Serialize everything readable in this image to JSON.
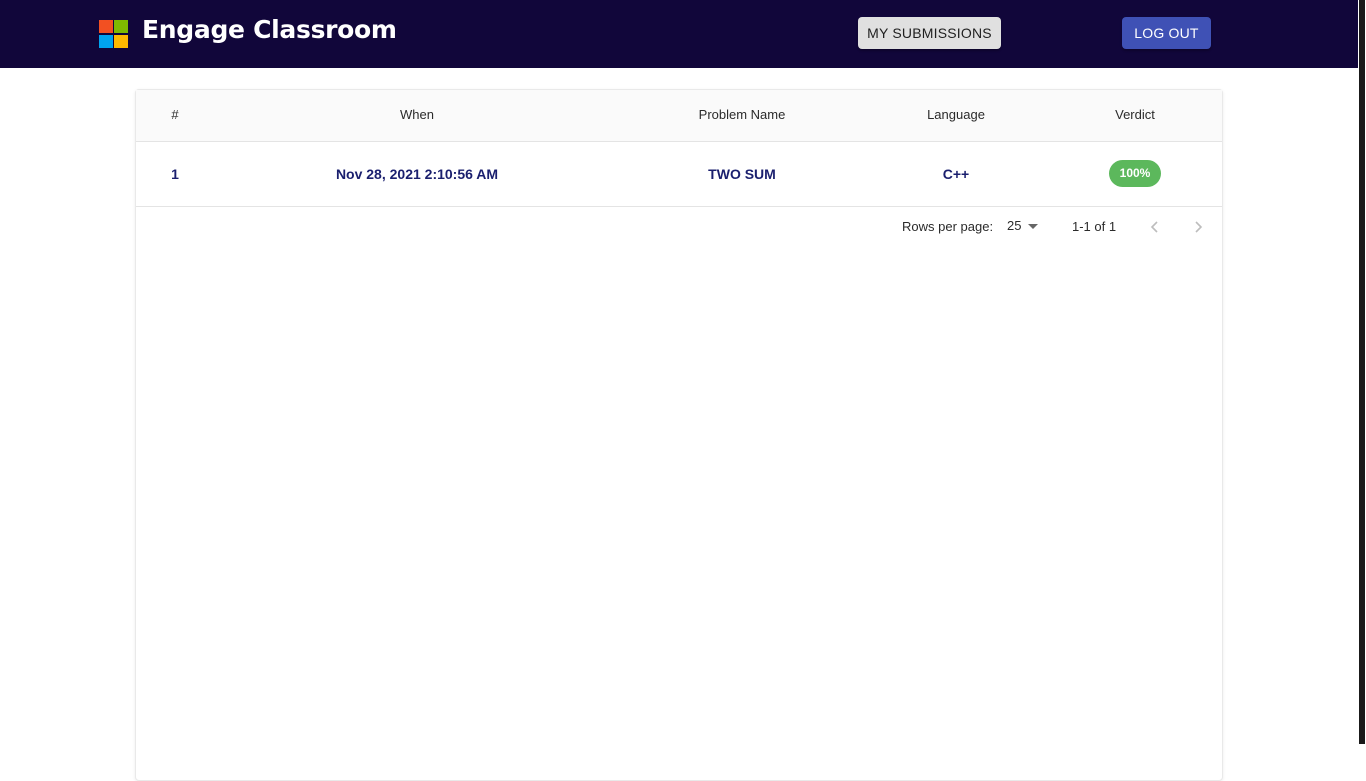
{
  "app": {
    "title": "Engage Classroom",
    "logo_colors": [
      "#f25022",
      "#7fba00",
      "#00a4ef",
      "#ffb900"
    ]
  },
  "header": {
    "my_submissions_label": "MY SUBMISSIONS",
    "logout_label": "LOG OUT"
  },
  "table": {
    "columns": [
      "#",
      "When",
      "Problem Name",
      "Language",
      "Verdict"
    ],
    "rows": [
      {
        "index": "1",
        "when": "Nov 28, 2021 2:10:56 AM",
        "problem": "TWO SUM",
        "language": "C++",
        "verdict": "100%",
        "verdict_color": "#5cb85c"
      }
    ]
  },
  "pagination": {
    "rows_per_page_label": "Rows per page:",
    "rows_per_page_value": "25",
    "range": "1-1 of 1",
    "prev_icon": "chevron-left-icon",
    "next_icon": "chevron-right-icon"
  }
}
